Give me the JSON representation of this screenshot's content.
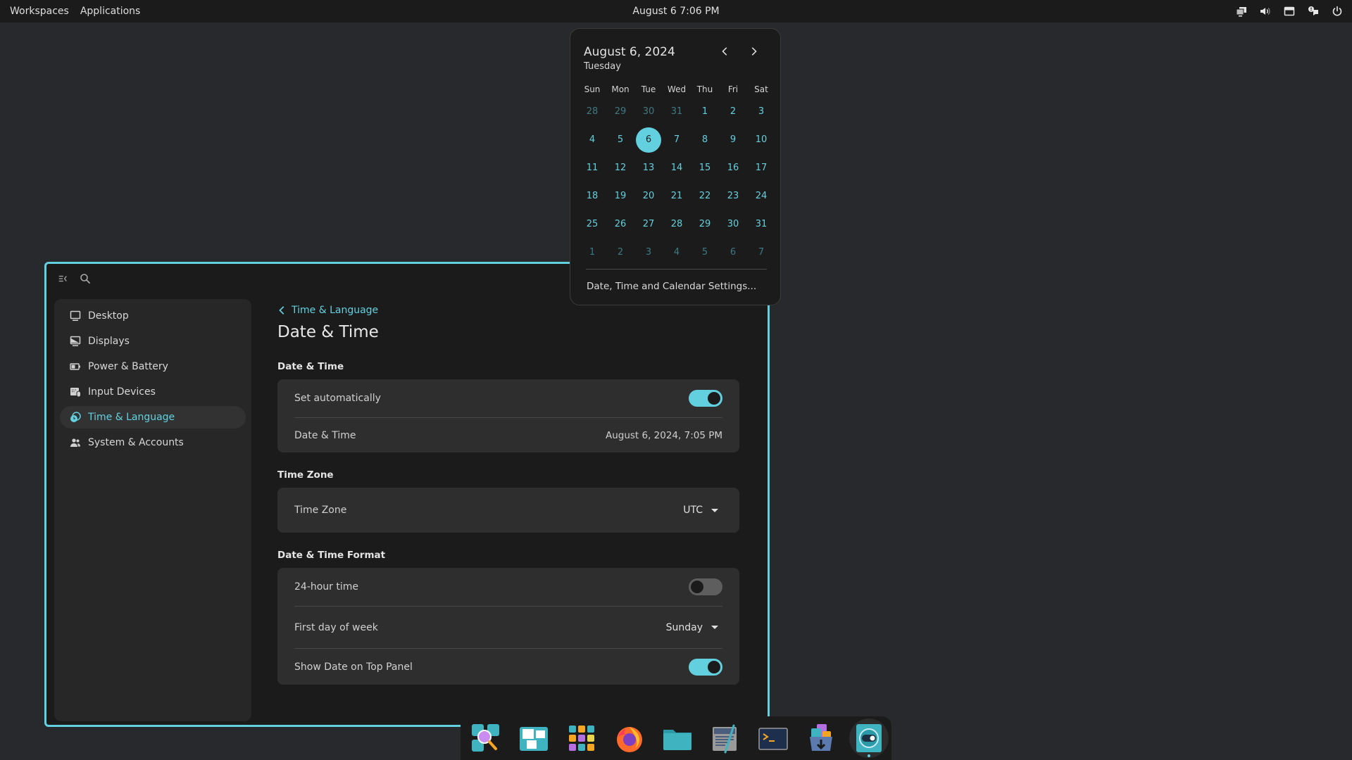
{
  "top_panel": {
    "workspaces_label": "Workspaces",
    "applications_label": "Applications",
    "clock": "August 6 7:06 PM",
    "tray_icons": [
      "display-icon",
      "volume-icon",
      "network-wired-icon",
      "notifications-icon",
      "power-icon"
    ]
  },
  "calendar": {
    "date_heading": "August 6, 2024",
    "weekday": "Tuesday",
    "weekday_headers": [
      "Sun",
      "Mon",
      "Tue",
      "Wed",
      "Thu",
      "Fri",
      "Sat"
    ],
    "weeks": [
      [
        {
          "d": "28",
          "m": true
        },
        {
          "d": "29",
          "m": true
        },
        {
          "d": "30",
          "m": true
        },
        {
          "d": "31",
          "m": true
        },
        {
          "d": "1"
        },
        {
          "d": "2"
        },
        {
          "d": "3"
        }
      ],
      [
        {
          "d": "4"
        },
        {
          "d": "5"
        },
        {
          "d": "6",
          "today": true
        },
        {
          "d": "7"
        },
        {
          "d": "8"
        },
        {
          "d": "9"
        },
        {
          "d": "10"
        }
      ],
      [
        {
          "d": "11"
        },
        {
          "d": "12"
        },
        {
          "d": "13"
        },
        {
          "d": "14"
        },
        {
          "d": "15"
        },
        {
          "d": "16"
        },
        {
          "d": "17"
        }
      ],
      [
        {
          "d": "18"
        },
        {
          "d": "19"
        },
        {
          "d": "20"
        },
        {
          "d": "21"
        },
        {
          "d": "22"
        },
        {
          "d": "23"
        },
        {
          "d": "24"
        }
      ],
      [
        {
          "d": "25"
        },
        {
          "d": "26"
        },
        {
          "d": "27"
        },
        {
          "d": "28"
        },
        {
          "d": "29"
        },
        {
          "d": "30"
        },
        {
          "d": "31"
        }
      ],
      [
        {
          "d": "1",
          "m": true
        },
        {
          "d": "2",
          "m": true
        },
        {
          "d": "3",
          "m": true
        },
        {
          "d": "4",
          "m": true
        },
        {
          "d": "5",
          "m": true
        },
        {
          "d": "6",
          "m": true
        },
        {
          "d": "7",
          "m": true
        }
      ]
    ],
    "settings_link": "Date, Time and Calendar Settings..."
  },
  "sidebar": {
    "items": [
      {
        "label": "Desktop",
        "icon": "desktop-icon",
        "active": false
      },
      {
        "label": "Displays",
        "icon": "displays-icon",
        "active": false
      },
      {
        "label": "Power & Battery",
        "icon": "battery-icon",
        "active": false
      },
      {
        "label": "Input Devices",
        "icon": "input-devices-icon",
        "active": false
      },
      {
        "label": "Time & Language",
        "icon": "time-language-icon",
        "active": true
      },
      {
        "label": "System & Accounts",
        "icon": "accounts-icon",
        "active": false
      }
    ]
  },
  "content": {
    "breadcrumb": "Time & Language",
    "title": "Date & Time",
    "sections": {
      "datetime": {
        "title": "Date & Time",
        "set_automatically_label": "Set automatically",
        "set_automatically": true,
        "datetime_label": "Date & Time",
        "datetime_value": "August 6, 2024, 7:05 PM"
      },
      "timezone": {
        "title": "Time Zone",
        "label": "Time Zone",
        "value": "UTC"
      },
      "format": {
        "title": "Date & Time Format",
        "hour24_label": "24-hour time",
        "hour24": false,
        "first_day_label": "First day of week",
        "first_day_value": "Sunday",
        "show_date_label": "Show Date on Top Panel",
        "show_date": true
      }
    }
  },
  "dock": {
    "items": [
      "launcher-icon",
      "workspaces-icon",
      "app-library-icon",
      "firefox-icon",
      "files-icon",
      "text-editor-icon",
      "terminal-icon",
      "store-icon",
      "settings-icon"
    ],
    "active_index": 8
  },
  "colors": {
    "accent": "#63d0df",
    "background": "#1b1b1b",
    "card": "#2e2e2e"
  }
}
